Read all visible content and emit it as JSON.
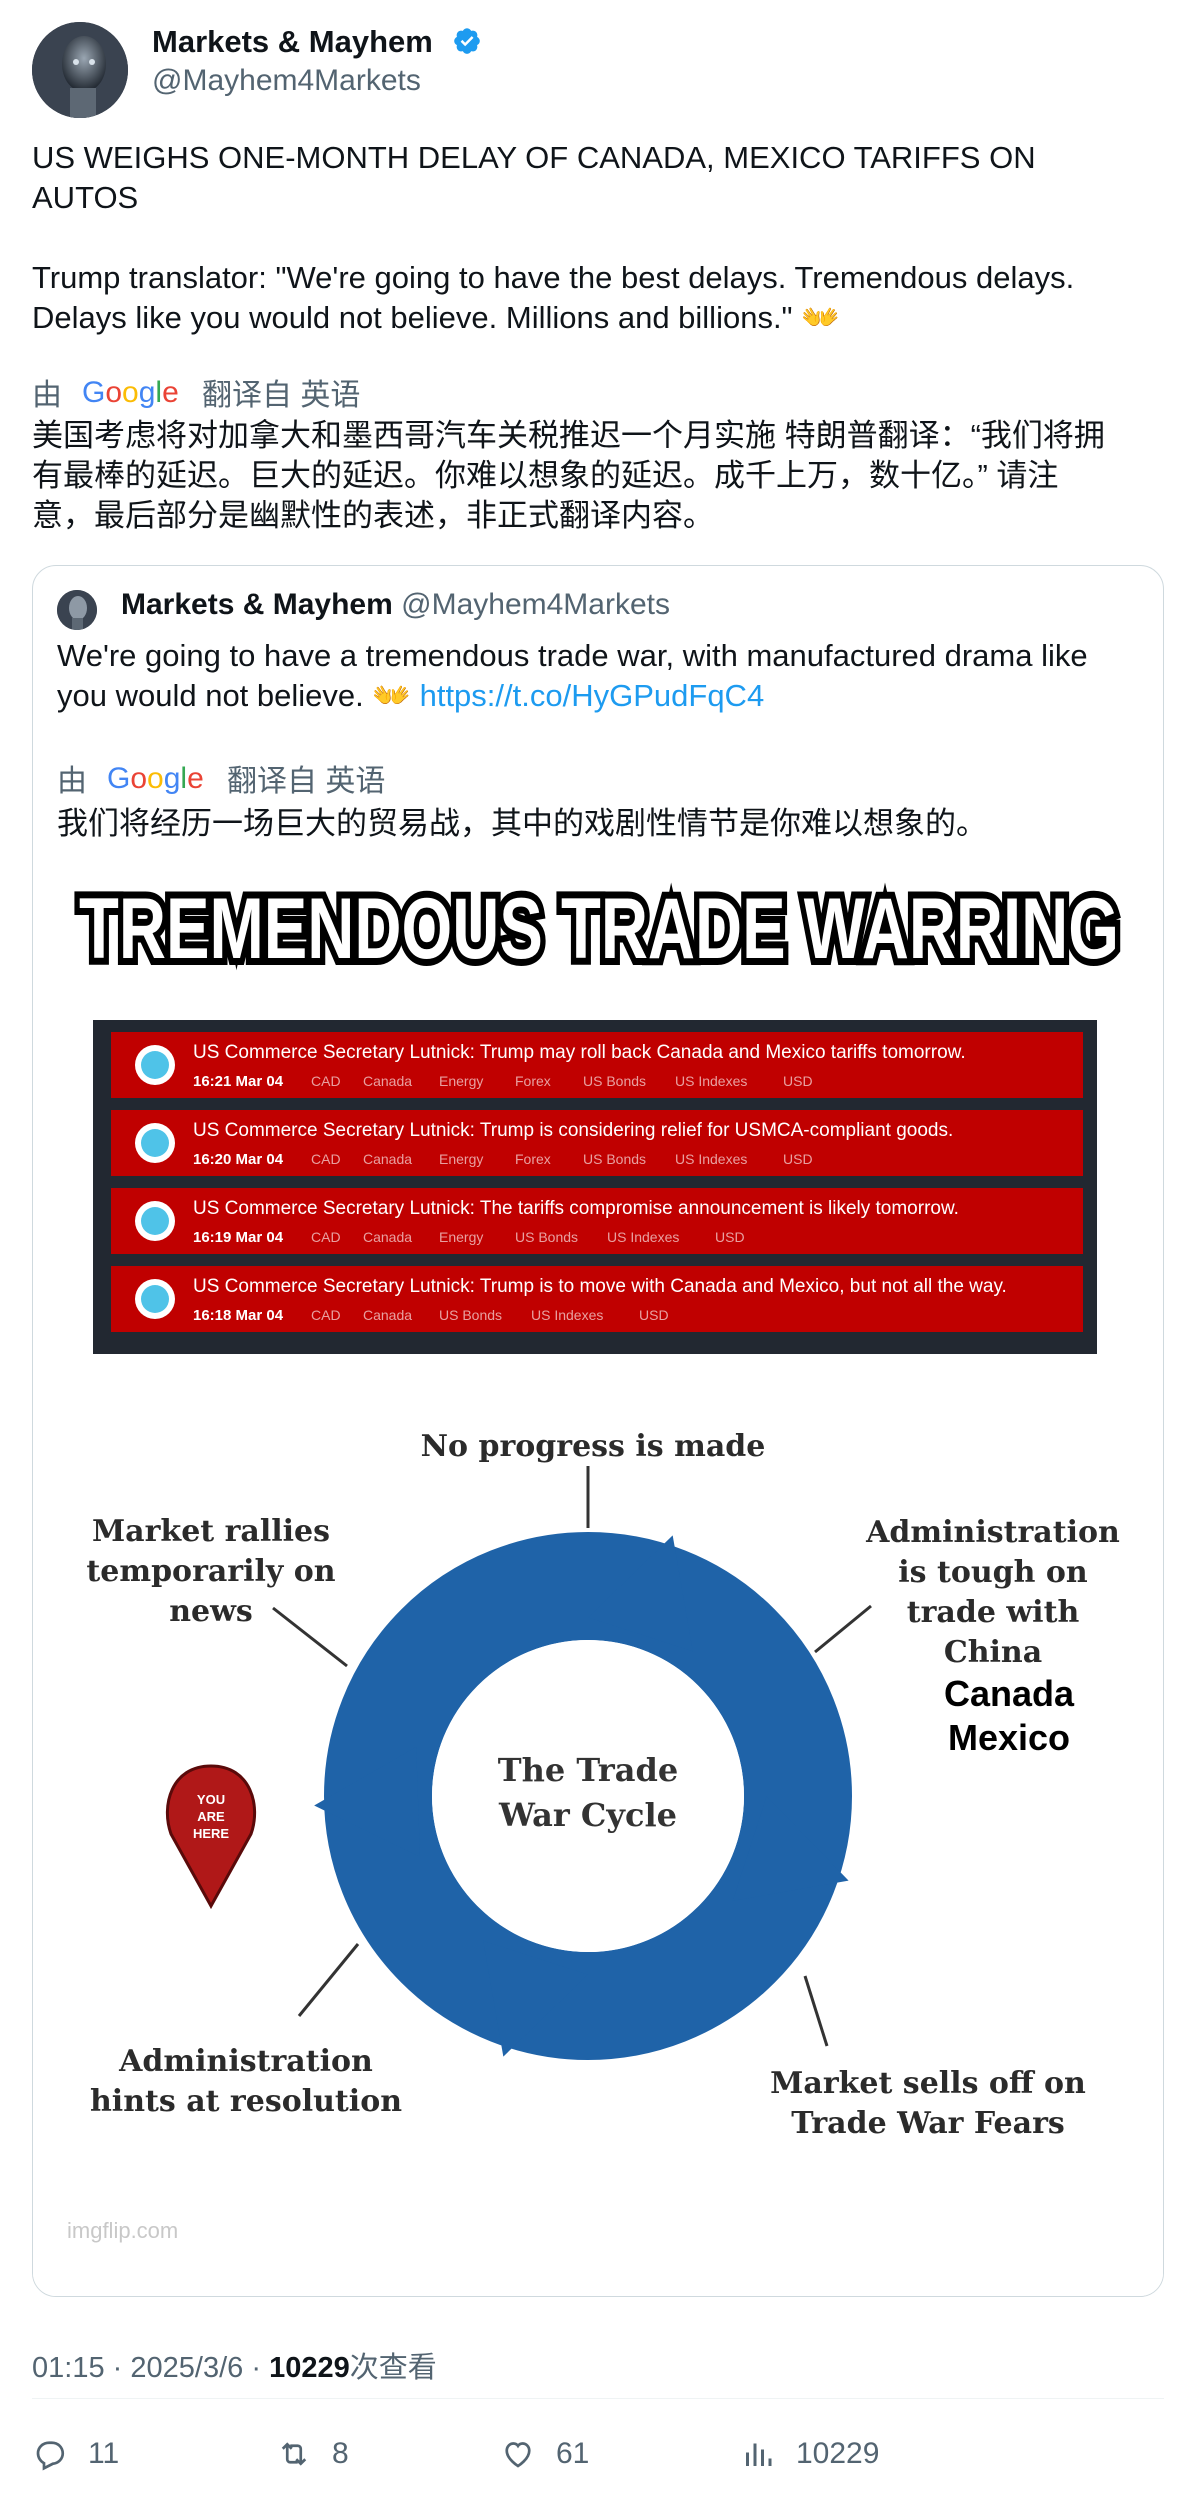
{
  "author": {
    "name": "Markets & Mayhem",
    "handle": "@Mayhem4Markets",
    "verified": true,
    "verified_icon": "verified-badge-icon"
  },
  "tweet": {
    "headline_line1": "US WEIGHS ONE-MONTH DELAY OF CANADA, MEXICO TARIFFS ON",
    "headline_line2": "AUTOS",
    "body_line1": "Trump translator: \"We're going to have the best delays. Tremendous delays.",
    "body_line2": "Delays like you would not believe. Millions and billions.\" 👐"
  },
  "translation": {
    "prefix": "由",
    "brand": "Google",
    "suffix": "翻译自 英语",
    "line1": "美国考虑将对加拿大和墨西哥汽车关税推迟一个月实施 特朗普翻译：“我们将拥",
    "line2": "有最棒的延迟。巨大的延迟。你难以想象的延迟。成千上万，数十亿。” 请注",
    "line3": "意，最后部分是幽默性的表述，非正式翻译内容。"
  },
  "quote": {
    "name": "Markets & Mayhem",
    "handle": "@Mayhem4Markets",
    "text_line1": "We're going to have a tremendous trade war, with manufactured drama like",
    "text_line2_prefix": "you would not believe. 👐 ",
    "link": "https://t.co/HyGPudFqC4",
    "translation_prefix": "由",
    "translation_brand": "Google",
    "translation_suffix": "翻译自 英语",
    "translation_text": "我们将经历一场巨大的贸易战，其中的戏剧性情节是你难以想象的。"
  },
  "meme": {
    "title": "TREMENDOUS TRADE WARRING",
    "headlines": [
      {
        "text": "US Commerce Secretary Lutnick: Trump may roll back Canada and Mexico tariffs tomorrow.",
        "time": "16:21 Mar 04",
        "tags": [
          "CAD",
          "Canada",
          "Energy",
          "Forex",
          "US Bonds",
          "US Indexes",
          "USD"
        ]
      },
      {
        "text": "US Commerce Secretary Lutnick: Trump is considering relief for USMCA-compliant goods.",
        "time": "16:20 Mar 04",
        "tags": [
          "CAD",
          "Canada",
          "Energy",
          "Forex",
          "US Bonds",
          "US Indexes",
          "USD"
        ]
      },
      {
        "text": "US Commerce Secretary Lutnick: The tariffs compromise announcement is likely tomorrow.",
        "time": "16:19 Mar 04",
        "tags": [
          "CAD",
          "Canada",
          "Energy",
          "US Bonds",
          "US Indexes",
          "USD"
        ]
      },
      {
        "text": "US Commerce Secretary Lutnick: Trump is to move with Canada and Mexico, but not all the way.",
        "time": "16:18 Mar 04",
        "tags": [
          "CAD",
          "Canada",
          "US Bonds",
          "US Indexes",
          "USD"
        ]
      }
    ],
    "cycle_center_line1": "The Trade",
    "cycle_center_line2": "War Cycle",
    "label_top": "No progress is made",
    "label_left_line1": "Market  rallies",
    "label_left_line2": "temporarily on",
    "label_left_line3": "news",
    "label_right_line1": "Administration",
    "label_right_line2": "is tough on",
    "label_right_line3": "trade with",
    "label_right_line4": "China",
    "label_right_extra1": "Canada",
    "label_right_extra2": "Mexico",
    "label_bottom_right_line1": "Market sells off on",
    "label_bottom_right_line2": "Trade War Fears",
    "label_bottom_left_line1": "Administration",
    "label_bottom_left_line2": "hints at resolution",
    "pin_line1": "YOU",
    "pin_line2": "ARE",
    "pin_line3": "HERE",
    "watermark": "imgflip.com"
  },
  "meta": {
    "time": "01:15",
    "date": "2025/3/6",
    "views_count": "10229",
    "views_label": "次查看",
    "separator": "·"
  },
  "actions": {
    "replies": "11",
    "retweets": "8",
    "likes": "61",
    "views": "10229"
  },
  "colors": {
    "link": "#1d9bf0",
    "secondary_text": "#536471",
    "cycle_blue": "#1f63a8",
    "headline_red": "#c00000"
  }
}
